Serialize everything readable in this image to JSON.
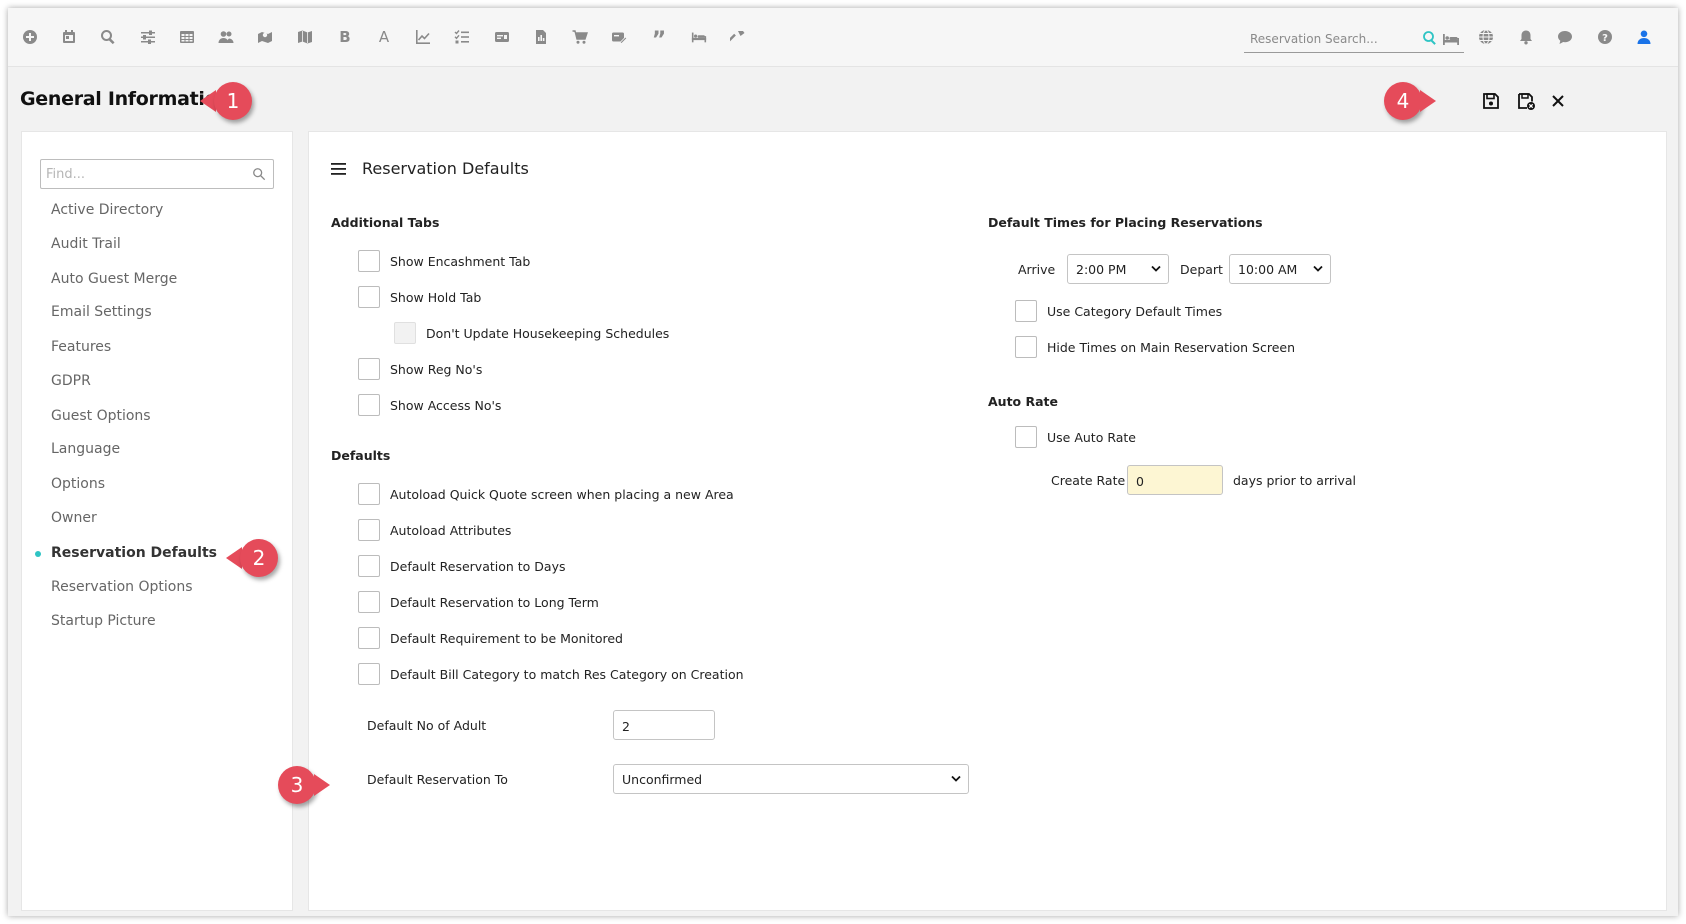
{
  "toolbar": {
    "icons": [
      "add-circle-icon",
      "calendar-icon",
      "search-icon",
      "sliders-icon",
      "grid-icon",
      "users-icon",
      "map-pins-icon",
      "map-icon",
      "bold-b-icon",
      "font-a-icon",
      "line-chart-icon",
      "checklist-icon",
      "id-card-icon",
      "document-icon",
      "cart-icon",
      "edit-card-icon",
      "quote-icon",
      "bed-icon",
      "hammer-icon"
    ],
    "bold_glyph": "B",
    "font_glyph": "A",
    "quote_glyph": "”",
    "search_placeholder": "Reservation Search...",
    "right_icons": [
      "globe-icon",
      "bell-icon",
      "chat-icon",
      "help-icon",
      "user-icon"
    ],
    "accent_color": "#1a73e8",
    "teal_color": "#2ec4c4"
  },
  "header": {
    "title": "General Information"
  },
  "callouts": {
    "one": "1",
    "two": "2",
    "three": "3",
    "four": "4",
    "color": "#e54b5a"
  },
  "sidebar": {
    "find_placeholder": "Find...",
    "items": [
      {
        "label": "Active Directory"
      },
      {
        "label": "Audit Trail"
      },
      {
        "label": "Auto Guest Merge"
      },
      {
        "label": "Email Settings"
      },
      {
        "label": "Features"
      },
      {
        "label": "GDPR"
      },
      {
        "label": "Guest Options"
      },
      {
        "label": "Language"
      },
      {
        "label": "Options"
      },
      {
        "label": "Owner"
      },
      {
        "label": "Reservation Defaults",
        "active": true
      },
      {
        "label": "Reservation Options"
      },
      {
        "label": "Startup Picture"
      }
    ]
  },
  "main": {
    "title": "Reservation Defaults",
    "additional_tabs": {
      "title": "Additional Tabs",
      "show_encashment": "Show Encashment Tab",
      "show_hold": "Show Hold Tab",
      "dont_update_housekeeping": "Don't Update Housekeeping Schedules",
      "show_reg_nos": "Show Reg No's",
      "show_access_nos": "Show Access No's"
    },
    "defaults": {
      "title": "Defaults",
      "autoload_quick_quote": "Autoload Quick Quote screen when placing a new Area",
      "autoload_attributes": "Autoload Attributes",
      "default_res_days": "Default Reservation to Days",
      "default_res_long_term": "Default Reservation to Long Term",
      "default_requirement_monitored": "Default Requirement to be Monitored",
      "default_bill_category": "Default Bill Category to match Res Category on Creation",
      "default_no_adult_label": "Default No of Adult",
      "default_no_adult_value": "2",
      "default_reservation_to_label": "Default Reservation To",
      "default_reservation_to_value": "Unconfirmed"
    },
    "default_times": {
      "title": "Default Times for Placing Reservations",
      "arrive_label": "Arrive",
      "arrive_value": "2:00 PM",
      "depart_label": "Depart",
      "depart_value": "10:00 AM",
      "use_category_default_times": "Use Category Default Times",
      "hide_times": "Hide Times on Main Reservation Screen"
    },
    "auto_rate": {
      "title": "Auto Rate",
      "use_auto_rate": "Use Auto Rate",
      "create_rate_label": "Create Rate",
      "create_rate_value": "0",
      "days_prior_label": "days prior to arrival"
    }
  }
}
